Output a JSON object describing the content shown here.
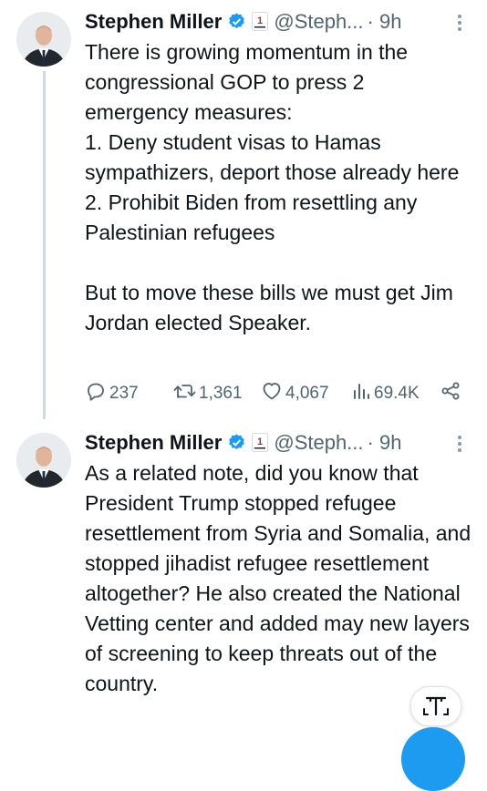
{
  "tweets": [
    {
      "author": "Stephen Miller",
      "handle": "@Steph...",
      "time": "· 9h",
      "text": "There is growing momentum in the congressional GOP to press 2 emergency measures:\n1. Deny student visas to Hamas sympathizers, deport those already here\n2. Prohibit Biden from resettling any Palestinian refugees\n\nBut to move these bills we must get Jim Jordan elected Speaker.",
      "replies": "237",
      "reposts": "1,361",
      "likes": "4,067",
      "views": "69.4K"
    },
    {
      "author": "Stephen Miller",
      "handle": "@Steph...",
      "time": "· 9h",
      "text": "As a related note, did you know that President Trump stopped refugee resettlement from Syria and Somalia, and stopped jihadist refugee resettlement altogether? He also created the National Vetting center and added may new layers of screening to keep threats out of the country."
    }
  ],
  "icons": {
    "verified": "verified-badge-icon",
    "affiliate": "affiliate-badge-icon",
    "more": "more-options-icon",
    "reply": "reply-icon",
    "repost": "repost-icon",
    "like": "like-icon",
    "views": "views-icon",
    "share": "share-icon",
    "translate": "translate-icon"
  },
  "colors": {
    "text": "#0f1419",
    "secondary": "#536471",
    "verified": "#1d9bf0",
    "thread_line": "#cfd9de"
  }
}
